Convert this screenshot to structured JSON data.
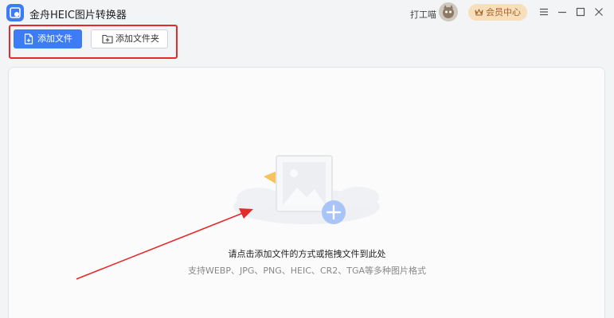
{
  "window": {
    "title": "金舟HEIC图片转换器",
    "username": "打工喵",
    "vip_label": "会员中心"
  },
  "toolbar": {
    "add_file_label": "添加文件",
    "add_folder_label": "添加文件夹"
  },
  "drop_zone": {
    "hint": "请点击添加文件的方式或拖拽文件到此处",
    "formats": "支持WEBP、JPG、PNG、HEIC、CR2、TGA等多种图片格式"
  },
  "colors": {
    "accent": "#3d7cf5",
    "annotation": "#e42b2b",
    "vip_bg": "#f6dfba",
    "vip_text": "#a4622a"
  },
  "icons": [
    "app-logo-icon",
    "avatar",
    "crown-icon",
    "menu-icon",
    "minimize-icon",
    "maximize-icon",
    "close-icon",
    "file-add-icon",
    "folder-add-icon",
    "image-placeholder-icon",
    "plus-icon"
  ]
}
